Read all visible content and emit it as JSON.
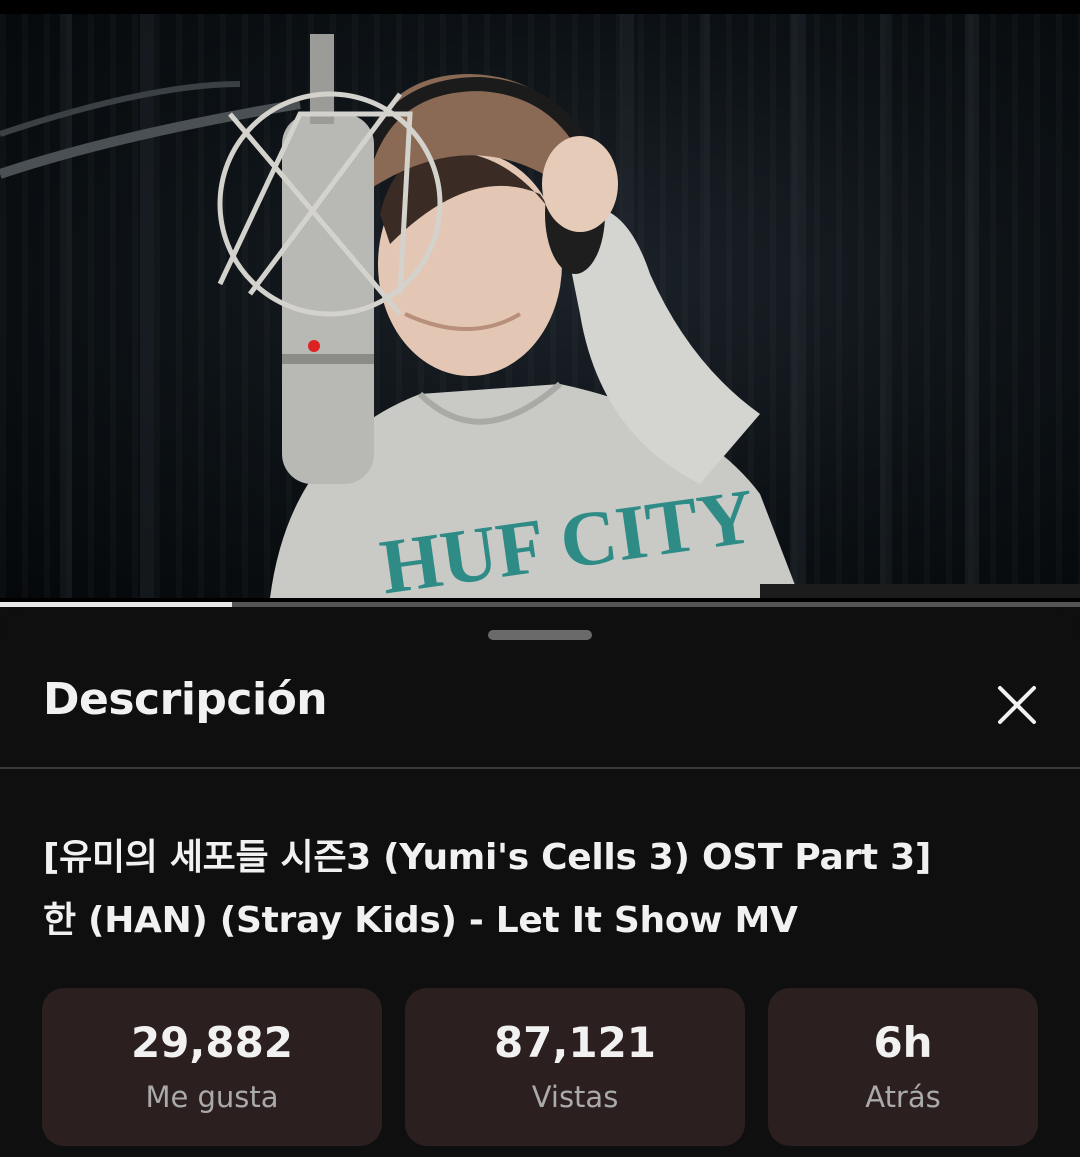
{
  "video": {
    "thumbnail_description_icon": "video-frame",
    "progress_fraction": 0.215
  },
  "description_sheet": {
    "title": "Descripción",
    "close_icon": "close-icon",
    "video_title_line1": "[유미의 세포들 시즌3 (Yumi's Cells 3) OST Part 3]",
    "video_title_line2": "한 (HAN) (Stray Kids) - Let It Show MV",
    "stats": [
      {
        "value": "29,882",
        "label": "Me gusta"
      },
      {
        "value": "87,121",
        "label": "Vistas"
      },
      {
        "value": "6h",
        "label": "Atrás"
      }
    ]
  },
  "colors": {
    "background": "#0f0f0f",
    "stat_card": "#2b1f1f",
    "text_primary": "#f1f1f1",
    "text_secondary": "#aaaaaa"
  }
}
